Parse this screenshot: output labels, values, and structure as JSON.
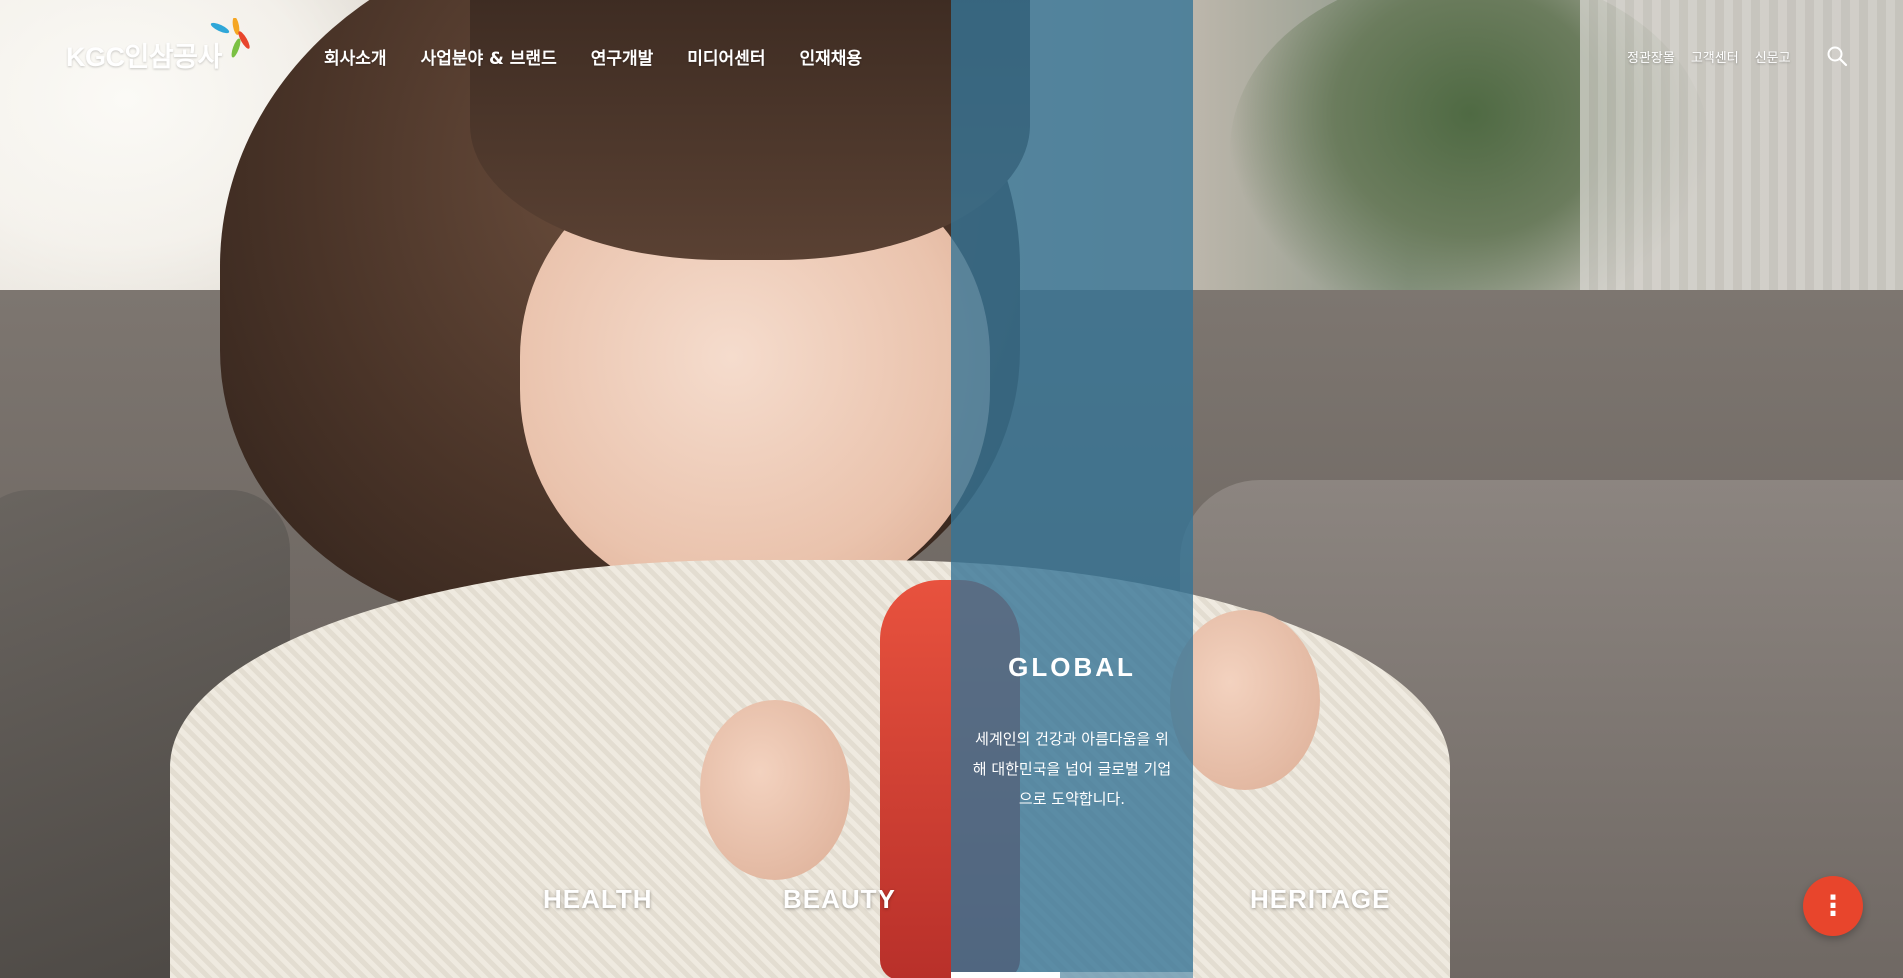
{
  "logo": {
    "text": "KGC인삼공사",
    "colors": [
      "#2fa7d8",
      "#e8452c",
      "#f5a623",
      "#7bc043"
    ]
  },
  "nav": {
    "items": [
      {
        "label": "회사소개"
      },
      {
        "label": "사업분야 & 브랜드"
      },
      {
        "label": "연구개발"
      },
      {
        "label": "미디어센터"
      },
      {
        "label": "인재채용"
      }
    ]
  },
  "utility": {
    "items": [
      {
        "label": "정관장몰"
      },
      {
        "label": "고객센터"
      },
      {
        "label": "신문고"
      }
    ],
    "search_icon": "search-icon"
  },
  "hero": {
    "categories": {
      "health": "HEALTH",
      "beauty": "BEAUTY",
      "global": "GLOBAL",
      "heritage": "HERITAGE"
    },
    "active_panel": {
      "title": "GLOBAL",
      "description": "세계인의 건강과 아름다움을 위해 대한민국을 넘어 글로벌 기업으로 도약합니다.",
      "progress": 0.45
    }
  },
  "fab": {
    "icon": "more-vertical-icon",
    "label": "⋮",
    "color": "#e8452c"
  },
  "colors": {
    "panel": "#367496",
    "accent": "#e8452c"
  }
}
